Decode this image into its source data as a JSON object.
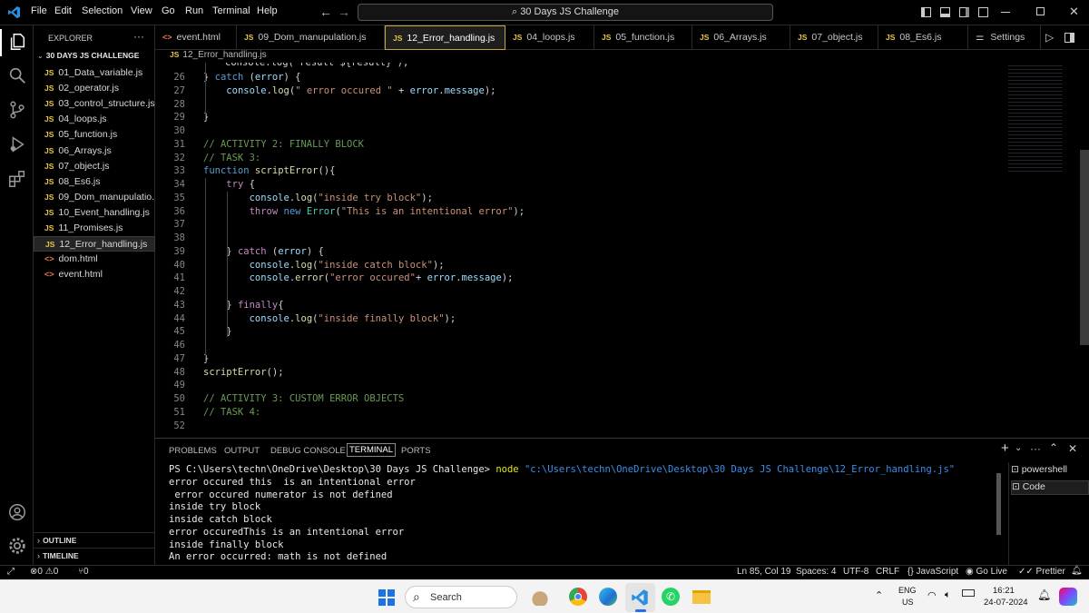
{
  "app": {
    "menus": [
      "File",
      "Edit",
      "Selection",
      "View",
      "Go",
      "Run",
      "Terminal",
      "Help"
    ],
    "search": "30 Days JS Challenge"
  },
  "explorer": {
    "title": "EXPLORER",
    "folder": "30 DAYS JS CHALLENGE",
    "outline": "OUTLINE",
    "timeline": "TIMELINE",
    "files": [
      {
        "t": "js",
        "n": "01_Data_variable.js"
      },
      {
        "t": "js",
        "n": "02_operator.js"
      },
      {
        "t": "js",
        "n": "03_control_structure.js"
      },
      {
        "t": "js",
        "n": "04_loops.js"
      },
      {
        "t": "js",
        "n": "05_function.js"
      },
      {
        "t": "js",
        "n": "06_Arrays.js"
      },
      {
        "t": "js",
        "n": "07_object.js"
      },
      {
        "t": "js",
        "n": "08_Es6.js"
      },
      {
        "t": "js",
        "n": "09_Dom_manupulatio..."
      },
      {
        "t": "js",
        "n": "10_Event_handling.js"
      },
      {
        "t": "js",
        "n": "11_Promises.js"
      },
      {
        "t": "js",
        "n": "12_Error_handling.js"
      },
      {
        "t": "html",
        "n": "dom.html"
      },
      {
        "t": "html",
        "n": "event.html"
      }
    ]
  },
  "tabs": [
    {
      "t": "html",
      "n": "event.html"
    },
    {
      "t": "js",
      "n": "09_Dom_manupulation.js"
    },
    {
      "t": "js",
      "n": "12_Error_handling.js"
    },
    {
      "t": "js",
      "n": "04_loops.js"
    },
    {
      "t": "js",
      "n": "05_function.js"
    },
    {
      "t": "js",
      "n": "06_Arrays.js"
    },
    {
      "t": "js",
      "n": "07_object.js"
    },
    {
      "t": "js",
      "n": "08_Es6.js"
    },
    {
      "t": "gear",
      "n": "Settings"
    }
  ],
  "breadcrumb": "12_Error_handling.js",
  "editor": {
    "partial_top": "console.log(`result ${result}`);",
    "lines": [
      {
        "n": "26",
        "h": "} <k>catch</k> (<v>error</v>) {"
      },
      {
        "n": "27",
        "h": "    <v>console</v>.<f>log</f>(<s>\" error occured \"</s> + <v>error</v>.<v>message</v>);"
      },
      {
        "n": "28",
        "h": ""
      },
      {
        "n": "29",
        "h": "}"
      },
      {
        "n": "30",
        "h": ""
      },
      {
        "n": "31",
        "h": "<c>// ACTIVITY 2: FINALLY BLOCK</c>"
      },
      {
        "n": "32",
        "h": "<c>// TASK 3:</c>"
      },
      {
        "n": "33",
        "h": "<k>function</k> <f>scriptError</f>(){"
      },
      {
        "n": "34",
        "h": "    <kp>try</kp> {"
      },
      {
        "n": "35",
        "h": "        <v>console</v>.<f>log</f>(<s>\"inside try block\"</s>);"
      },
      {
        "n": "36",
        "h": "        <kp>throw</kp> <k>new</k> <cl>Error</cl>(<s>\"This is an intentional error\"</s>);"
      },
      {
        "n": "37",
        "h": ""
      },
      {
        "n": "38",
        "h": ""
      },
      {
        "n": "39",
        "h": "    } <kp>catch</kp> (<v>error</v>) {"
      },
      {
        "n": "40",
        "h": "        <v>console</v>.<f>log</f>(<s>\"inside catch block\"</s>);"
      },
      {
        "n": "41",
        "h": "        <v>console</v>.<f>error</f>(<s>\"error occured\"</s>+ <v>error</v>.<v>message</v>);"
      },
      {
        "n": "42",
        "h": ""
      },
      {
        "n": "43",
        "h": "    } <kp>finally</kp>{"
      },
      {
        "n": "44",
        "h": "        <v>console</v>.<f>log</f>(<s>\"inside finally block\"</s>);"
      },
      {
        "n": "45",
        "h": "    }"
      },
      {
        "n": "46",
        "h": ""
      },
      {
        "n": "47",
        "h": "}"
      },
      {
        "n": "48",
        "h": "<f>scriptError</f>();"
      },
      {
        "n": "49",
        "h": ""
      },
      {
        "n": "50",
        "h": "<c>// ACTIVITY 3: CUSTOM ERROR OBJECTS</c>"
      },
      {
        "n": "51",
        "h": "<c>// TASK 4:</c>"
      },
      {
        "n": "52",
        "h": ""
      }
    ]
  },
  "panel": {
    "tabs": [
      "PROBLEMS",
      "OUTPUT",
      "DEBUG CONSOLE",
      "TERMINAL",
      "PORTS"
    ],
    "prompt": "PS C:\\Users\\techn\\OneDrive\\Desktop\\30 Days JS Challenge>",
    "cmd": "node",
    "arg": "\"c:\\Users\\techn\\OneDrive\\Desktop\\30 Days JS Challenge\\12_Error_handling.js\"",
    "output": [
      "error occured this  is an intentional error",
      " error occured numerator is not defined",
      "inside try block",
      "inside catch block",
      "error occuredThis is an intentional error",
      "inside finally block",
      "An error occurred: math is not defined"
    ],
    "terminals": [
      "powershell",
      "Code"
    ]
  },
  "status": {
    "errors": "0",
    "warnings": "0",
    "ports": "0",
    "position": "Ln 85, Col 19",
    "spaces": "Spaces: 4",
    "encoding": "UTF-8",
    "eol": "CRLF",
    "language": "JavaScript",
    "golive": "Go Live",
    "prettier": "Prettier"
  },
  "taskbar": {
    "search": "Search",
    "lang1": "ENG",
    "lang2": "US",
    "time": "16:21",
    "date": "24-07-2024"
  }
}
